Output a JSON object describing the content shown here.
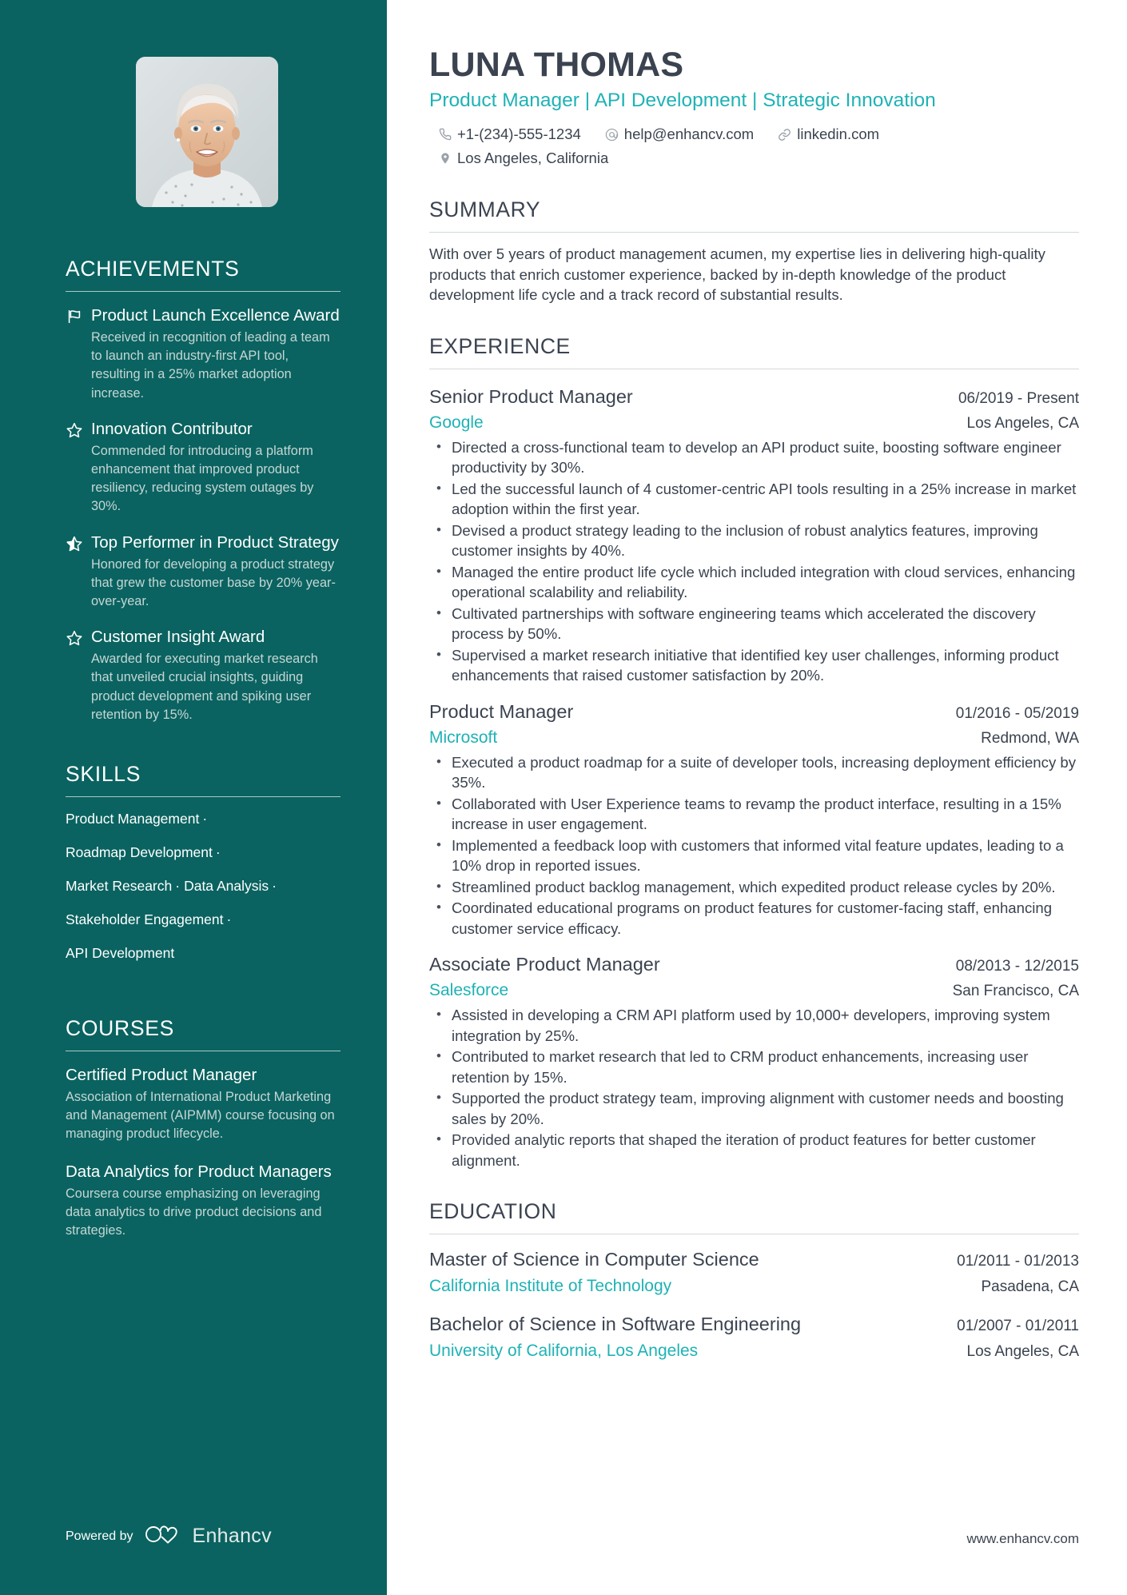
{
  "theme": {
    "sidebar_bg": "#0a6360",
    "accent": "#1fb2b5",
    "text_dark": "#3b4350",
    "muted_light": "#c5d6d5"
  },
  "header": {
    "name": "LUNA THOMAS",
    "headline": "Product Manager | API Development | Strategic Innovation",
    "contacts": [
      {
        "icon": "phone-icon",
        "text": "+1-(234)-555-1234"
      },
      {
        "icon": "email-icon",
        "text": "help@enhancv.com"
      },
      {
        "icon": "link-icon",
        "text": "linkedin.com"
      },
      {
        "icon": "location-icon",
        "text": "Los Angeles, California"
      }
    ]
  },
  "sidebar": {
    "achievements": {
      "heading": "ACHIEVEMENTS",
      "items": [
        {
          "icon": "flag-icon",
          "title": "Product Launch Excellence Award",
          "description": "Received in recognition of leading a team to launch an industry-first API tool, resulting in a 25% market adoption increase."
        },
        {
          "icon": "star-outline-icon",
          "title": "Innovation Contributor",
          "description": "Commended for introducing a platform enhancement that improved product resiliency, reducing system outages by 30%."
        },
        {
          "icon": "star-half-icon",
          "title": "Top Performer in Product Strategy",
          "description": "Honored for developing a product strategy that grew the customer base by 20% year-over-year."
        },
        {
          "icon": "star-outline-icon",
          "title": "Customer Insight Award",
          "description": "Awarded for executing market research that unveiled crucial insights, guiding product development and spiking user retention by 15%."
        }
      ]
    },
    "skills": {
      "heading": "SKILLS",
      "separator": "·",
      "lines": [
        [
          "Product Management"
        ],
        [
          "Roadmap Development"
        ],
        [
          "Market Research",
          "Data Analysis"
        ],
        [
          "Stakeholder Engagement"
        ],
        [
          "API Development"
        ]
      ]
    },
    "courses": {
      "heading": "COURSES",
      "items": [
        {
          "title": "Certified Product Manager",
          "description": "Association of International Product Marketing and Management (AIPMM) course focusing on managing product lifecycle."
        },
        {
          "title": "Data Analytics for Product Managers",
          "description": "Coursera course emphasizing on leveraging data analytics to drive product decisions and strategies."
        }
      ]
    },
    "footer": {
      "powered_by": "Powered by",
      "brand": "Enhancv"
    }
  },
  "main": {
    "summary": {
      "heading": "SUMMARY",
      "text": "With over 5 years of product management acumen, my expertise lies in delivering high-quality products that enrich customer experience, backed by in-depth knowledge of the product development life cycle and a track record of substantial results."
    },
    "experience": {
      "heading": "EXPERIENCE",
      "jobs": [
        {
          "title": "Senior Product Manager",
          "date": "06/2019 - Present",
          "company": "Google",
          "location": "Los Angeles, CA",
          "bullets": [
            "Directed a cross-functional team to develop an API product suite, boosting software engineer productivity by 30%.",
            "Led the successful launch of 4 customer-centric API tools resulting in a 25% increase in market adoption within the first year.",
            "Devised a product strategy leading to the inclusion of robust analytics features, improving customer insights by 40%.",
            "Managed the entire product life cycle which included integration with cloud services, enhancing operational scalability and reliability.",
            "Cultivated partnerships with software engineering teams which accelerated the discovery process by 50%.",
            "Supervised a market research initiative that identified key user challenges, informing product enhancements that raised customer satisfaction by 20%."
          ]
        },
        {
          "title": "Product Manager",
          "date": "01/2016 - 05/2019",
          "company": "Microsoft",
          "location": "Redmond, WA",
          "bullets": [
            "Executed a product roadmap for a suite of developer tools, increasing deployment efficiency by 35%.",
            "Collaborated with User Experience teams to revamp the product interface, resulting in a 15% increase in user engagement.",
            "Implemented a feedback loop with customers that informed vital feature updates, leading to a 10% drop in reported issues.",
            "Streamlined product backlog management, which expedited product release cycles by 20%.",
            "Coordinated educational programs on product features for customer-facing staff, enhancing customer service efficacy."
          ]
        },
        {
          "title": "Associate Product Manager",
          "date": "08/2013 - 12/2015",
          "company": "Salesforce",
          "location": "San Francisco, CA",
          "bullets": [
            "Assisted in developing a CRM API platform used by 10,000+ developers, improving system integration by 25%.",
            "Contributed to market research that led to CRM product enhancements, increasing user retention by 15%.",
            "Supported the product strategy team, improving alignment with customer needs and boosting sales by 20%.",
            "Provided analytic reports that shaped the iteration of product features for better customer alignment."
          ]
        }
      ]
    },
    "education": {
      "heading": "EDUCATION",
      "items": [
        {
          "degree": "Master of Science in Computer Science",
          "date": "01/2011 - 01/2013",
          "school": "California Institute of Technology",
          "location": "Pasadena, CA"
        },
        {
          "degree": "Bachelor of Science in Software Engineering",
          "date": "01/2007 - 01/2011",
          "school": "University of California, Los Angeles",
          "location": "Los Angeles, CA"
        }
      ]
    },
    "footer": {
      "website": "www.enhancv.com"
    }
  }
}
